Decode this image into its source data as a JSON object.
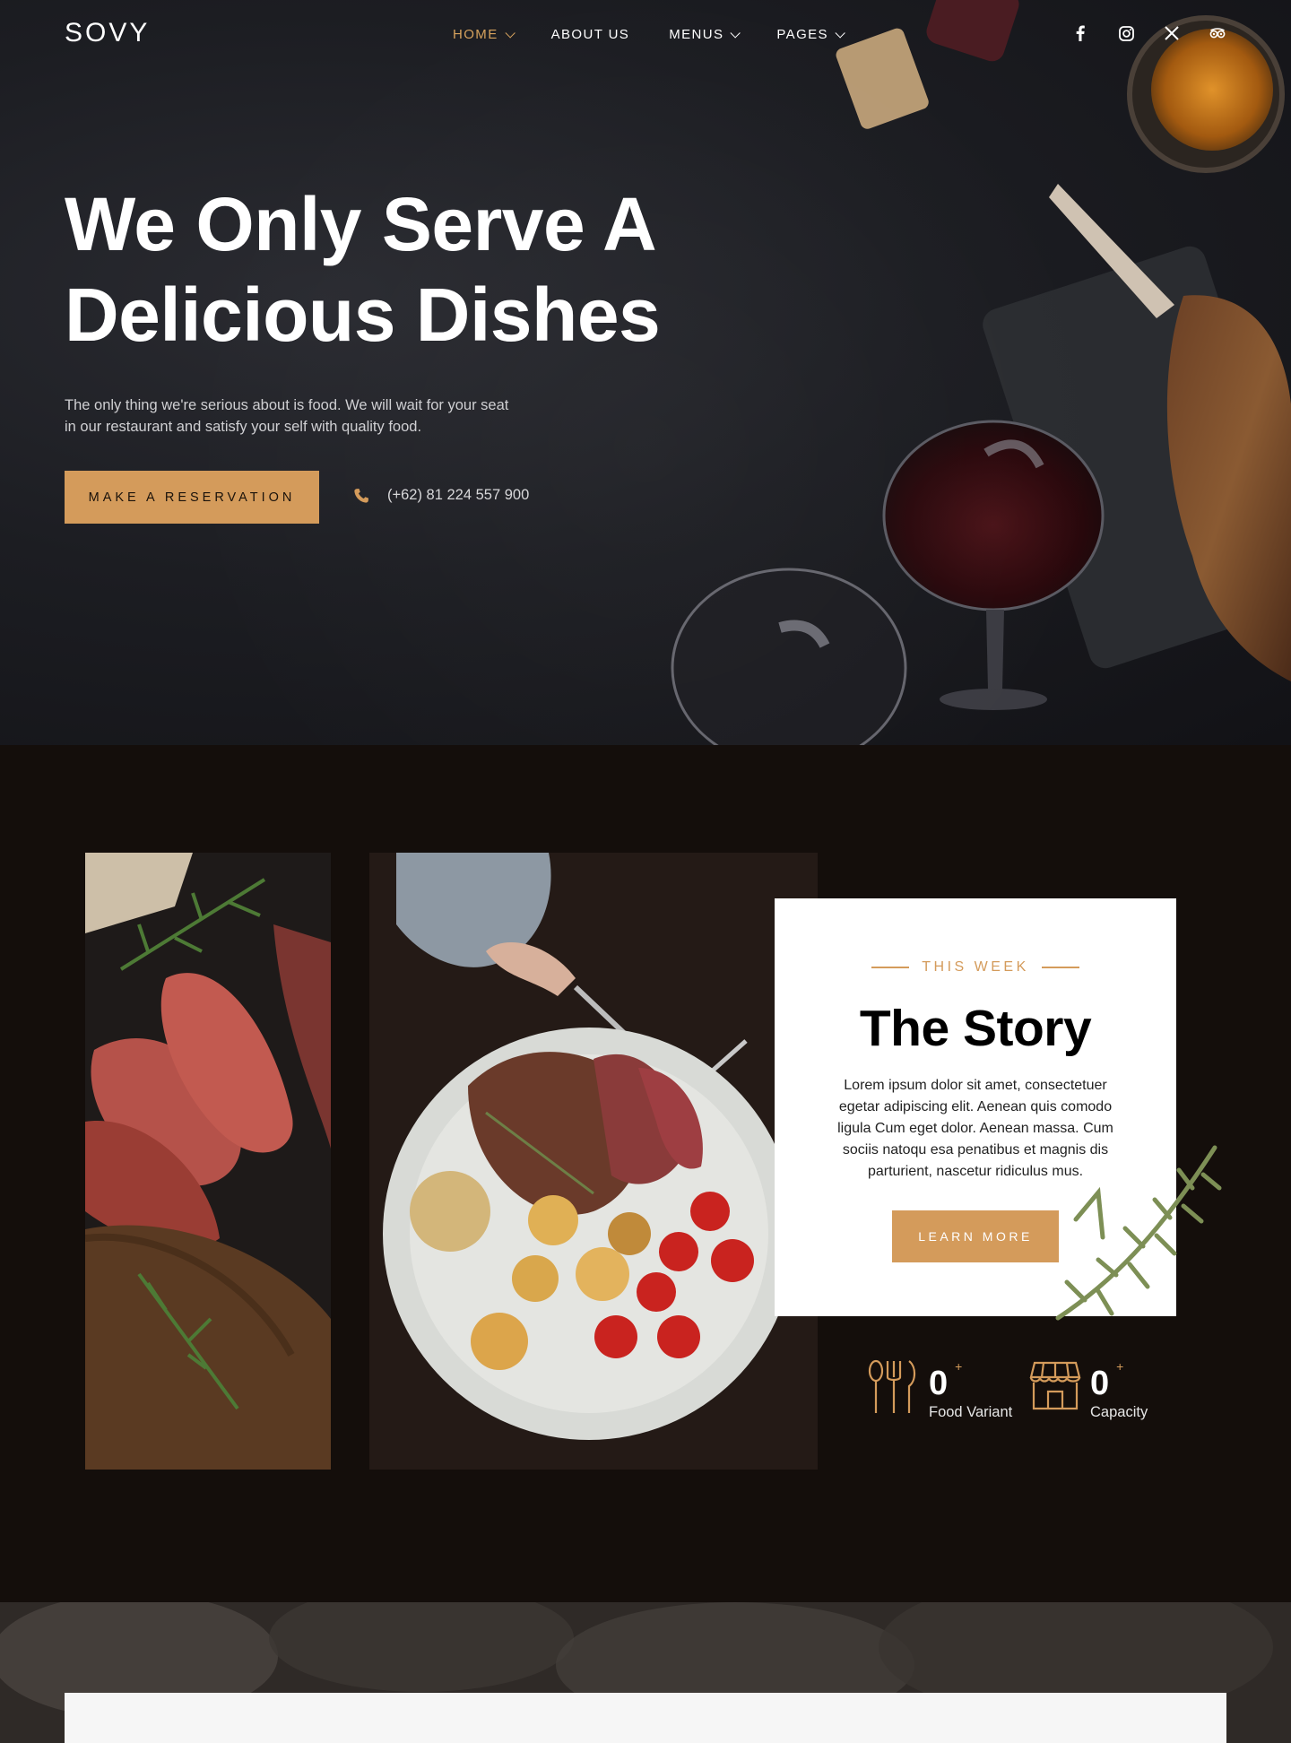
{
  "brand": {
    "logo": "SOVY",
    "accent": "#d49b5b"
  },
  "nav": {
    "items": [
      {
        "label": "HOME",
        "active": true,
        "has_dropdown": true
      },
      {
        "label": "ABOUT US",
        "active": false,
        "has_dropdown": false
      },
      {
        "label": "MENUS",
        "active": false,
        "has_dropdown": true
      },
      {
        "label": "PAGES",
        "active": false,
        "has_dropdown": true
      }
    ]
  },
  "socials": [
    "facebook-icon",
    "instagram-icon",
    "x-icon",
    "tripadvisor-icon"
  ],
  "hero": {
    "title_line1": "We Only Serve A",
    "title_line2": "Delicious Dishes",
    "text_line1": "The only thing we're serious about is food. We will wait for your seat",
    "text_line2": "in our restaurant and satisfy your self with quality food.",
    "cta": "MAKE A RESERVATION",
    "phone": "(+62) 81 224 557 900"
  },
  "story": {
    "eyebrow": "THIS WEEK",
    "title": "The Story",
    "text_lines": [
      "Lorem ipsum dolor sit amet, consectetuer",
      "egetar adipiscing elit. Aenean quis comodo",
      "ligula Cum eget dolor. Aenean massa. Cum",
      "sociis natoqu esa penatibus et magnis dis",
      "parturient, nascetur ridiculus mus."
    ],
    "cta": "LEARN MORE"
  },
  "stats": [
    {
      "value": "0",
      "plus": "+",
      "label": "Food Variant",
      "icon": "cutlery-icon"
    },
    {
      "value": "0",
      "plus": "+",
      "label": "Capacity",
      "icon": "storefront-icon"
    }
  ]
}
